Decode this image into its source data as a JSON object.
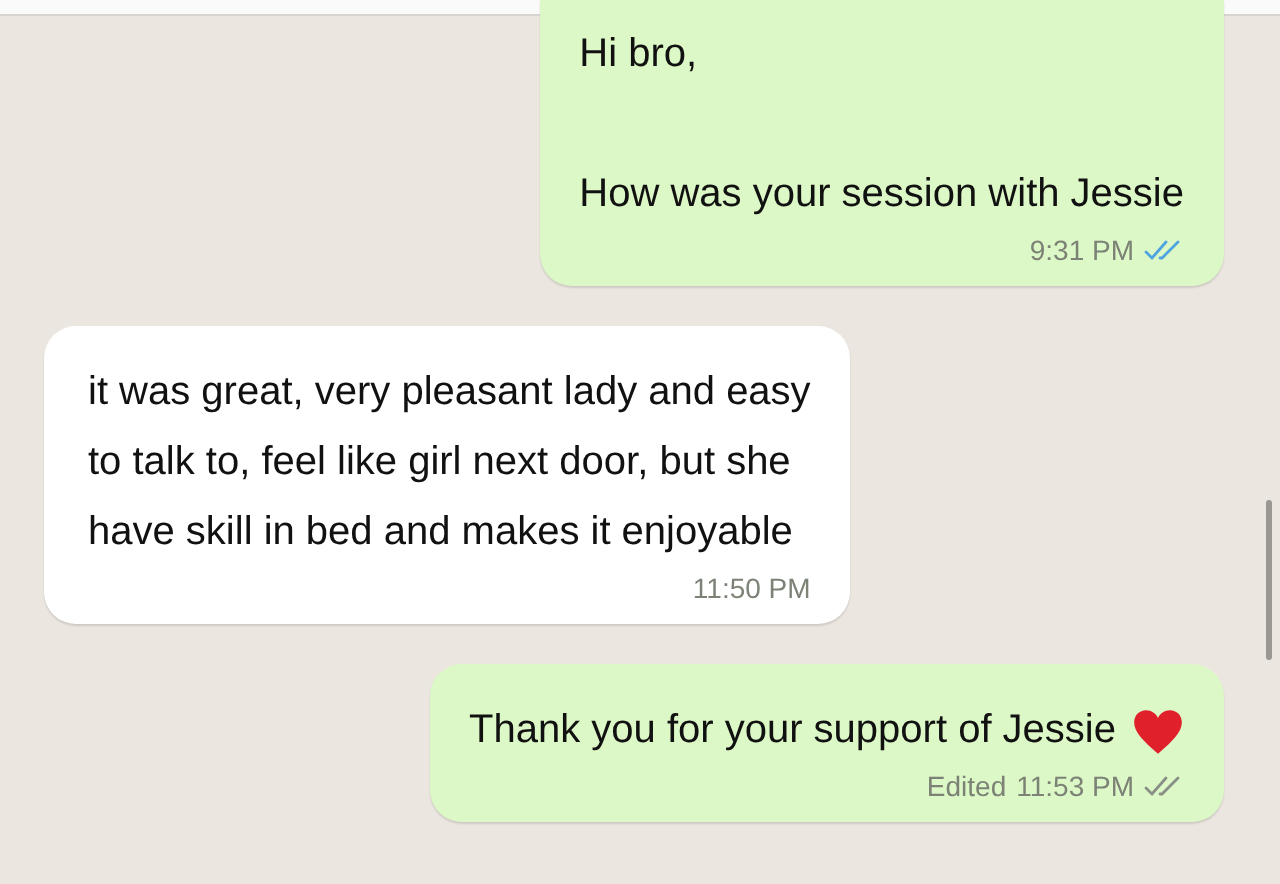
{
  "messages": [
    {
      "kind": "outgoing",
      "text": "Hi bro,\n\nHow was your session with Jessie",
      "time": "9:31 PM",
      "read": true
    },
    {
      "kind": "incoming",
      "text": "it was great, very pleasant lady and easy\nto talk to, feel like girl next door, but she\nhave skill in bed and makes it enjoyable",
      "time": "11:50 PM"
    },
    {
      "kind": "outgoing",
      "text": "Thank you for your support of Jessie",
      "heart": true,
      "edited_label": "Edited",
      "time": "11:53 PM",
      "read": false
    }
  ]
}
